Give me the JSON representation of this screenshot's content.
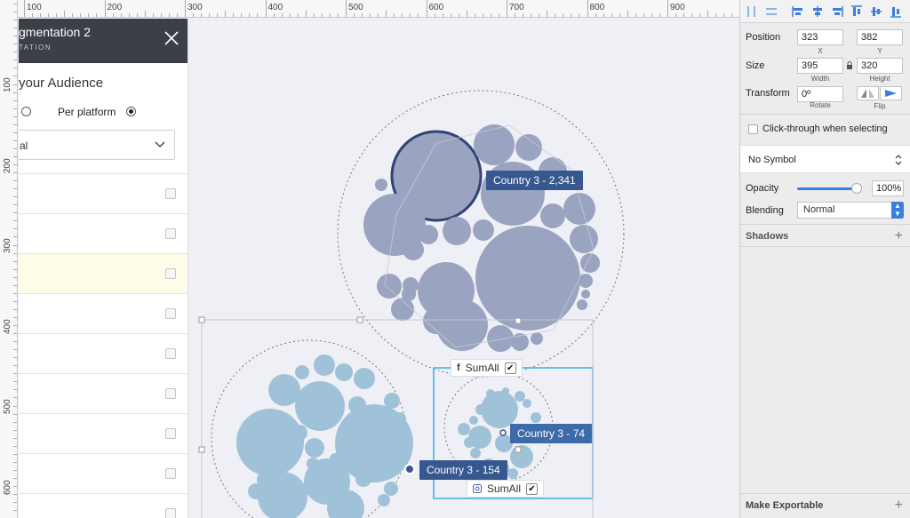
{
  "ruler": {
    "top_labels": [
      "100",
      "200",
      "300",
      "400",
      "500",
      "600",
      "700",
      "800",
      "900"
    ],
    "left_labels": [
      "100",
      "200",
      "300",
      "400",
      "500",
      "600"
    ]
  },
  "artboard_panel": {
    "title": "gmentation 2",
    "subtitle": "TATION",
    "audience_heading": "your Audience",
    "per_platform_label": "Per platform",
    "select_value": "al",
    "rows": [
      {
        "highlight": false
      },
      {
        "highlight": false
      },
      {
        "highlight": true
      },
      {
        "highlight": false
      },
      {
        "highlight": false
      },
      {
        "highlight": false
      },
      {
        "highlight": false
      },
      {
        "highlight": false
      },
      {
        "highlight": false
      }
    ]
  },
  "canvas": {
    "tooltips": {
      "top": "Country 3 - 2,341",
      "right": "Country 3 - 74",
      "left": "Country 3 - 154"
    },
    "chips": {
      "upper": {
        "icon": "f",
        "label": "SumAll"
      },
      "lower": {
        "icon": "instagram",
        "label": "SumAll"
      }
    },
    "colors": {
      "slate_bubble": "#9aa3bf",
      "blue_bubble": "#9fc2d9",
      "selection": "#3aaee0",
      "tooltip": "#37578f"
    }
  },
  "inspector": {
    "position_label": "Position",
    "x_value": "323",
    "y_value": "382",
    "x_label": "X",
    "y_label": "Y",
    "size_label": "Size",
    "width_value": "395",
    "height_value": "320",
    "width_label": "Width",
    "height_label": "Height",
    "transform_label": "Transform",
    "rotate_value": "0º",
    "rotate_label": "Rotate",
    "flip_label": "Flip",
    "clickthrough_label": "Click-through when selecting",
    "symbol_value": "No Symbol",
    "opacity_label": "Opacity",
    "opacity_value": "100%",
    "opacity_fraction": 1.0,
    "blending_label": "Blending",
    "blending_value": "Normal",
    "shadows_label": "Shadows",
    "exportable_label": "Make Exportable"
  }
}
